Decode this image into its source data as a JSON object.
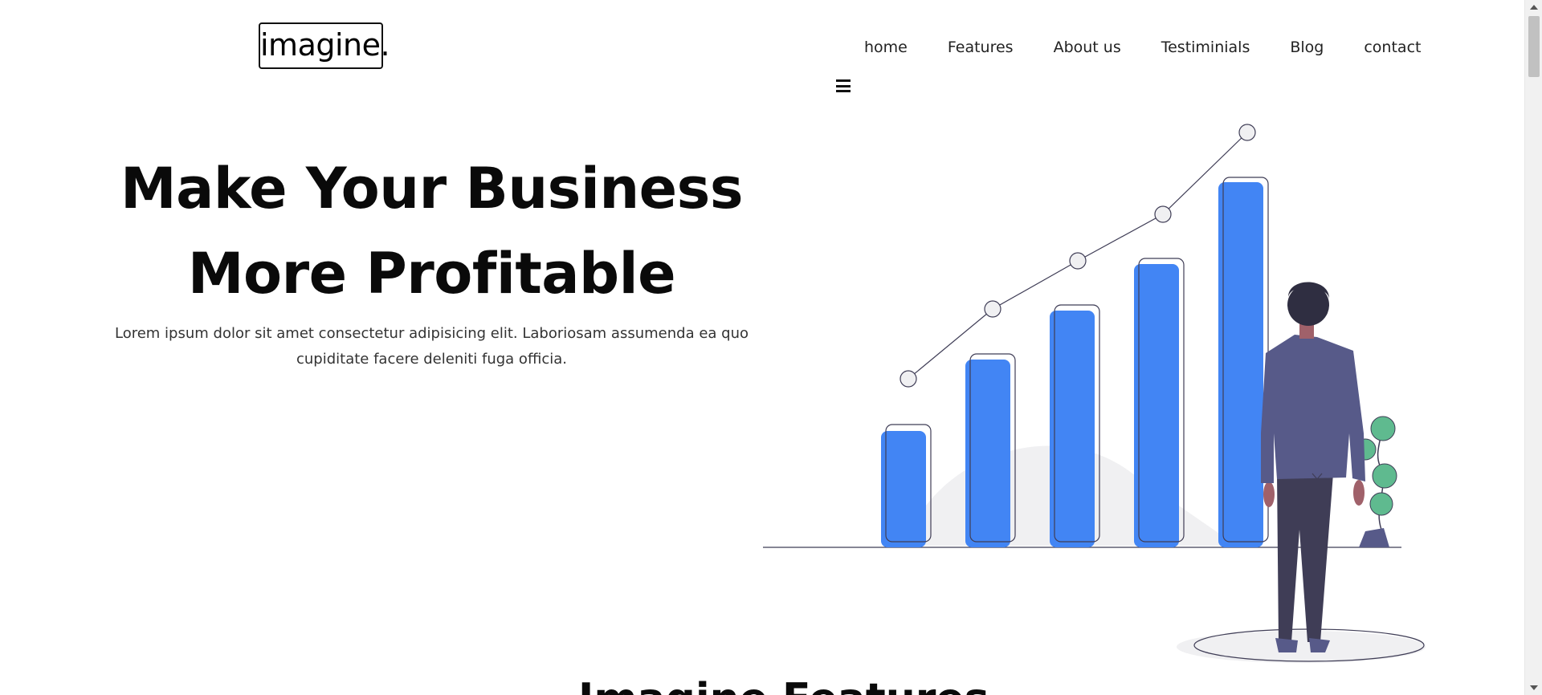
{
  "header": {
    "logo_text": "imagine.",
    "nav": [
      {
        "label": "home"
      },
      {
        "label": "Features"
      },
      {
        "label": "About us"
      },
      {
        "label": "Testiminials"
      },
      {
        "label": "Blog"
      },
      {
        "label": "contact"
      }
    ],
    "menu_icon": "hamburger-icon"
  },
  "hero": {
    "title_line1": "Make Your Business",
    "title_line2": "More Profitable",
    "description": "Lorem ipsum dolor sit amet consectetur adipisicing elit. Laboriosam assumenda ea quo cupiditate facere deleniti fuga officia."
  },
  "illustration": {
    "bar_count": 5,
    "bar_color": "#4285f4",
    "person_color": "#575a89",
    "plant_color": "#5fba8f"
  },
  "features": {
    "title": "Imagine Features"
  },
  "colors": {
    "text_dark": "#0a0a0a",
    "accent_blue": "#4285f4"
  }
}
